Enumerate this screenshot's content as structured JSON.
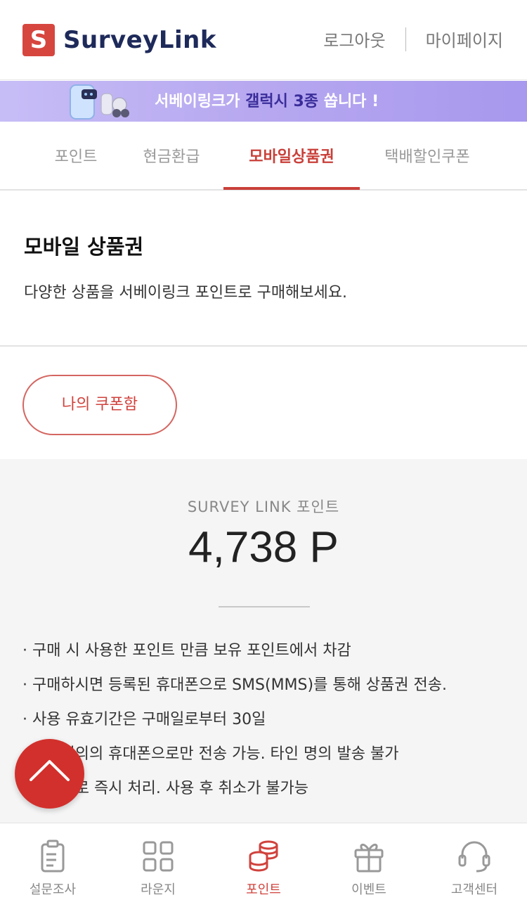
{
  "header": {
    "logo_letter": "S",
    "logo_text": "SurveyLink",
    "logout_label": "로그아웃",
    "mypage_label": "마이페이지"
  },
  "banner": {
    "headline_part1": "서베이링크가 ",
    "headline_part2": "갤럭시 3종 ",
    "headline_part3": "쏩니다 !"
  },
  "tabs": [
    {
      "label": "포인트"
    },
    {
      "label": "현금환급"
    },
    {
      "label": "모바일상품권",
      "active": true
    },
    {
      "label": "택배할인쿠폰"
    }
  ],
  "intro": {
    "title": "모바일 상품권",
    "description": "다양한 상품을 서베이링크 포인트로 구매해보세요."
  },
  "coupon_button": {
    "label": "나의 쿠폰함"
  },
  "points": {
    "label": "SURVEY LINK 포인트",
    "value": "4,738 P"
  },
  "notes": [
    "· 구매 시 사용한 포인트 만큼 보유 포인트에서 차감",
    "· 구매하시면 등록된 휴대폰으로 SMS(MMS)를 통해 상품권 전송.",
    "· 사용 유효기간은 구매일로부터 30일",
    "· 본인명의의 휴대폰으로만 전송 가능. 타인 명의 발송 불가",
    "· 자동으로 즉시 처리. 사용 후 취소가 불가능"
  ],
  "bottom_nav": [
    {
      "label": "설문조사",
      "icon": "clipboard-icon"
    },
    {
      "label": "라운지",
      "icon": "grid-icon"
    },
    {
      "label": "포인트",
      "icon": "coins-icon",
      "active": true
    },
    {
      "label": "이벤트",
      "icon": "gift-icon"
    },
    {
      "label": "고객센터",
      "icon": "headset-icon"
    }
  ],
  "colors": {
    "accent": "#c9403a",
    "logo_red": "#d6463f",
    "logo_navy": "#1e2a5a",
    "banner_purple": "#b8a9f0",
    "fab_red": "#d2302c"
  }
}
